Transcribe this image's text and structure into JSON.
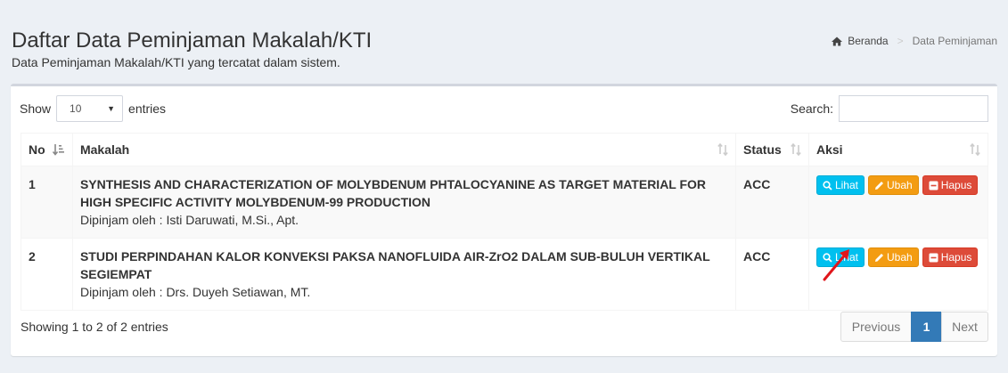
{
  "header": {
    "title": "Daftar Data Peminjaman Makalah/KTI",
    "subtitle": "Data Peminjaman Makalah/KTI yang tercatat dalam sistem."
  },
  "breadcrumb": {
    "home_label": "Beranda",
    "current_label": "Data Peminjaman"
  },
  "controls": {
    "show_label": "Show",
    "entries_value": "10",
    "entries_label": "entries",
    "search_label": "Search:",
    "search_value": ""
  },
  "table": {
    "columns": [
      "No",
      "Makalah",
      "Status",
      "Aksi"
    ],
    "rows": [
      {
        "no": "1",
        "title": "SYNTHESIS AND CHARACTERIZATION OF MOLYBDENUM PHTALOCYANINE AS TARGET MATERIAL FOR HIGH SPECIFIC ACTIVITY MOLYBDENUM-99 PRODUCTION",
        "borrower": "Dipinjam oleh : Isti Daruwati, M.Si., Apt.",
        "status": "ACC"
      },
      {
        "no": "2",
        "title": "STUDI PERPINDAHAN KALOR KONVEKSI PAKSA NANOFLUIDA AIR-ZrO2 DALAM SUB-BULUH VERTIKAL SEGIEMPAT",
        "borrower": "Dipinjam oleh : Drs. Duyeh Setiawan, MT.",
        "status": "ACC"
      }
    ],
    "actions": {
      "view_label": "Lihat",
      "edit_label": "Ubah",
      "delete_label": "Hapus"
    }
  },
  "footer": {
    "info": "Showing 1 to 2 of 2 entries",
    "prev_label": "Previous",
    "current_page": "1",
    "next_label": "Next"
  },
  "colors": {
    "info": "#00c0ef",
    "warning": "#f39c12",
    "danger": "#dd4b39",
    "primary": "#337ab7",
    "annotation_arrow": "#e0161b"
  }
}
